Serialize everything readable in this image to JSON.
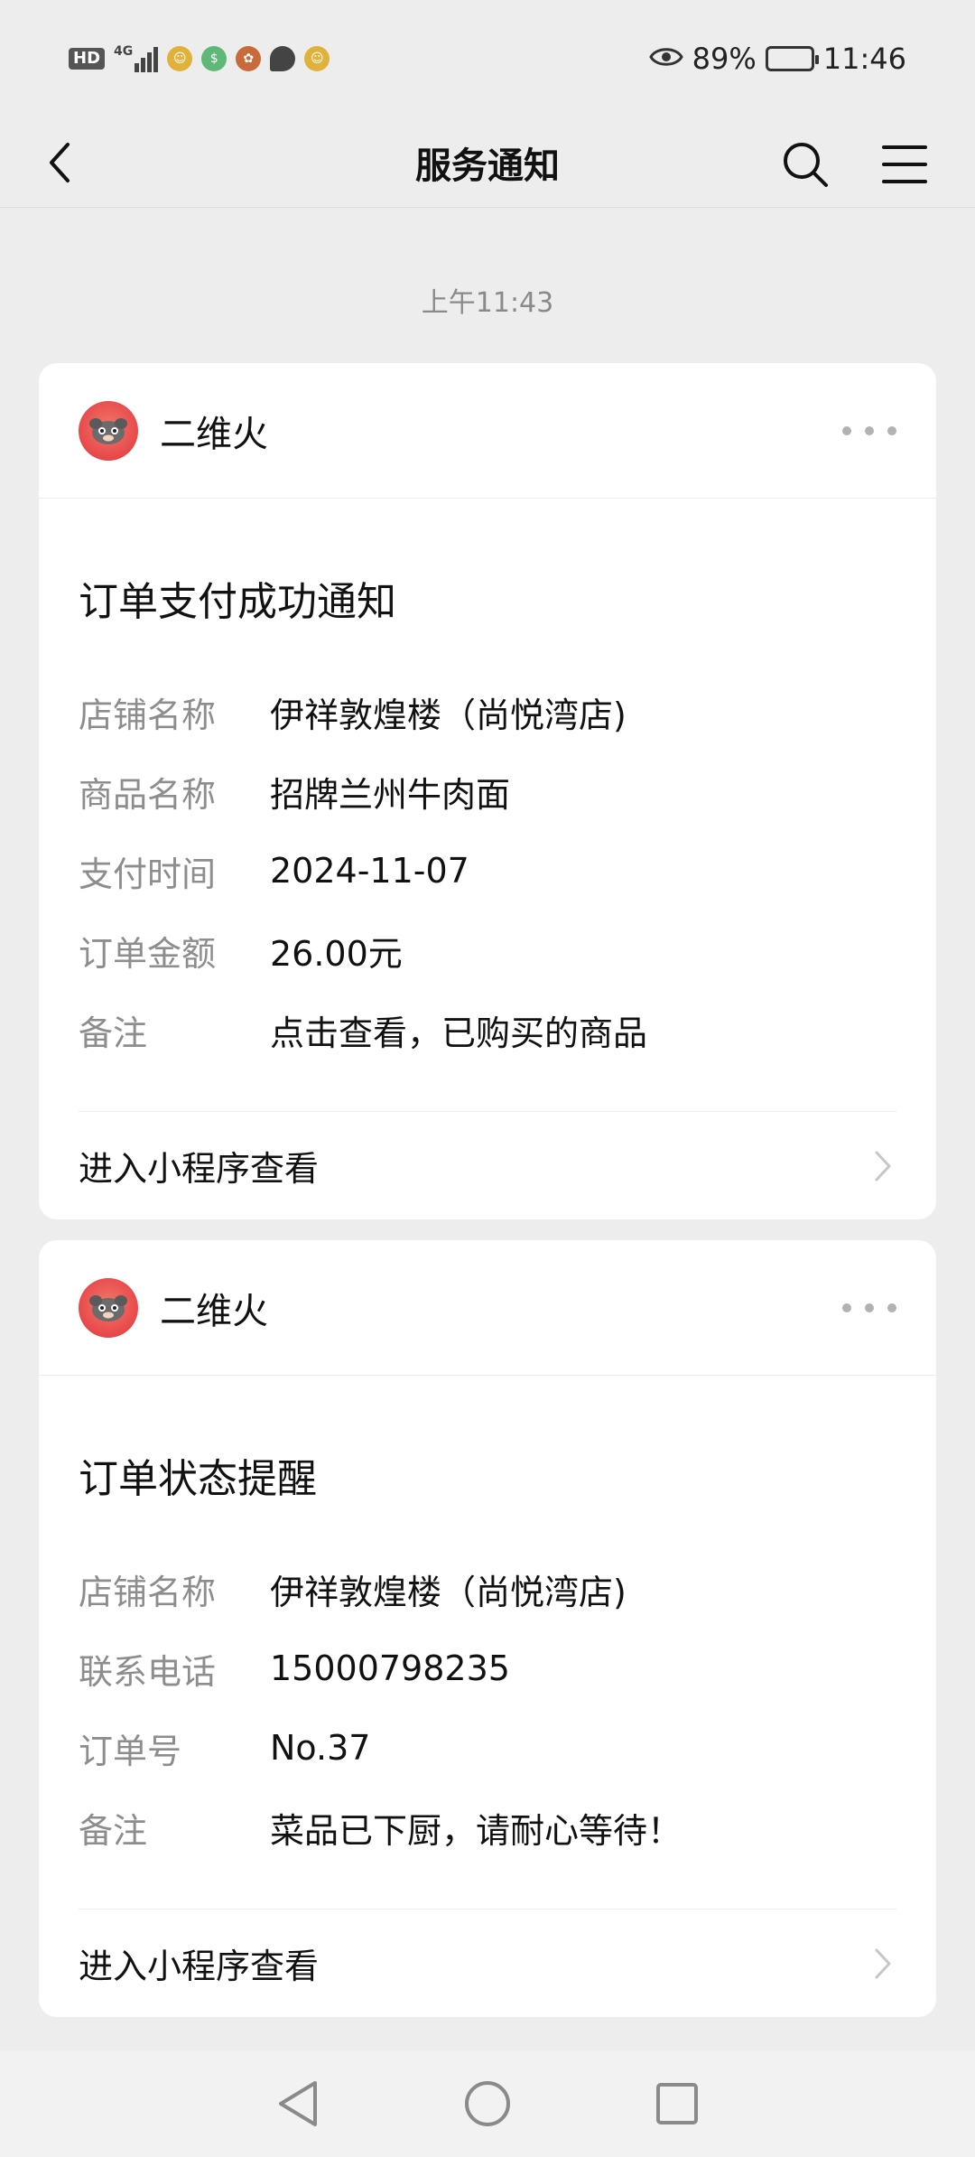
{
  "status_bar": {
    "hd": "HD",
    "network": "4G",
    "battery_percent": "89%",
    "battery_level": 0.89,
    "time": "11:46"
  },
  "nav": {
    "title": "服务通知"
  },
  "timestamp": "上午11:43",
  "cards": [
    {
      "source": "二维火",
      "title": "订单支付成功通知",
      "rows": [
        {
          "key": "店铺名称",
          "value": "伊祥敦煌楼（尚悦湾店)"
        },
        {
          "key": "商品名称",
          "value": "招牌兰州牛肉面"
        },
        {
          "key": "支付时间",
          "value": "2024-11-07"
        },
        {
          "key": "订单金额",
          "value": "26.00元"
        },
        {
          "key": "备注",
          "value": "点击查看，已购买的商品"
        }
      ],
      "footer": "进入小程序查看"
    },
    {
      "source": "二维火",
      "title": "订单状态提醒",
      "rows": [
        {
          "key": "店铺名称",
          "value": "伊祥敦煌楼（尚悦湾店)"
        },
        {
          "key": "联系电话",
          "value": "15000798235"
        },
        {
          "key": "订单号",
          "value": "No.37"
        },
        {
          "key": "备注",
          "value": "菜品已下厨，请耐心等待！"
        }
      ],
      "footer": "进入小程序查看"
    }
  ]
}
